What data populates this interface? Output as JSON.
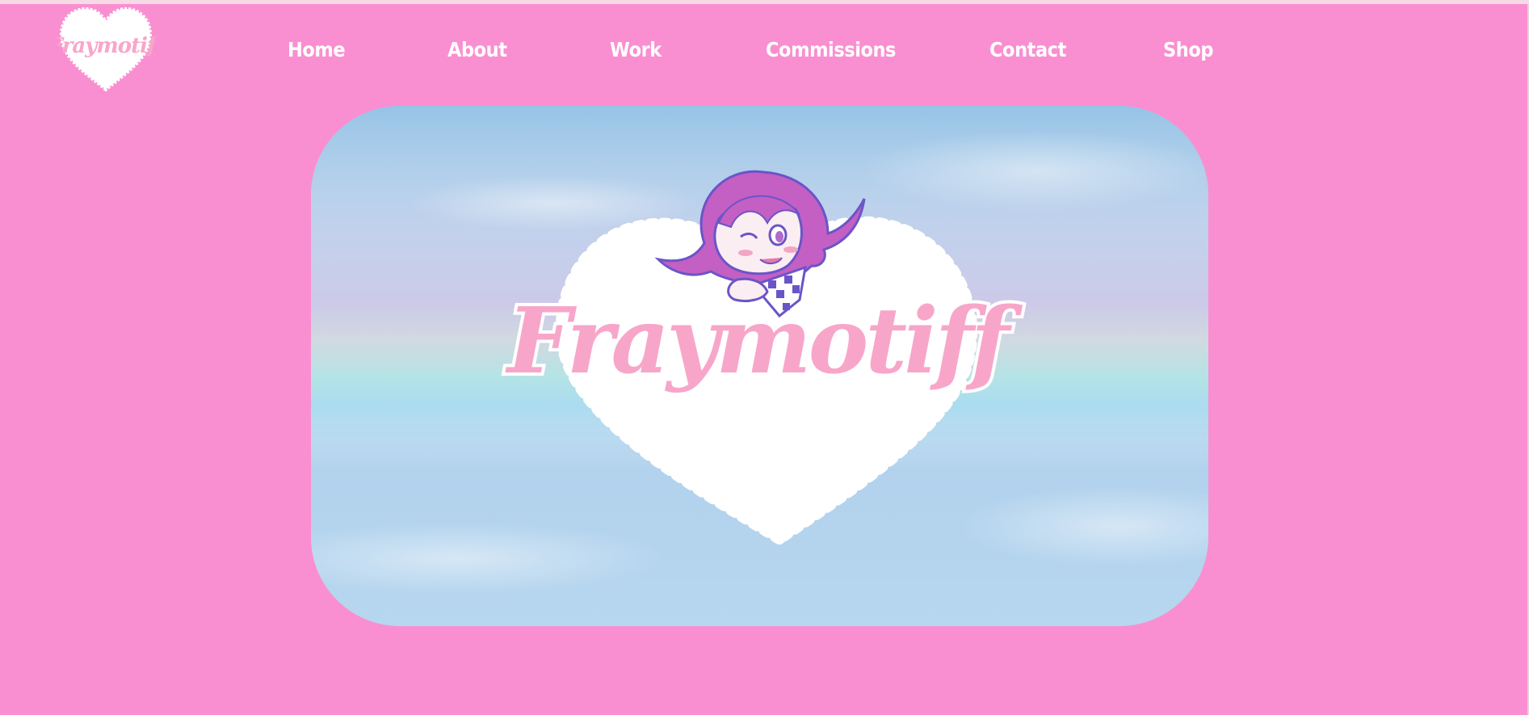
{
  "header": {
    "logo_text": "Fraymotiff",
    "nav": [
      {
        "label": "Home"
      },
      {
        "label": "About"
      },
      {
        "label": "Work"
      },
      {
        "label": "Commissions"
      },
      {
        "label": "Contact"
      },
      {
        "label": "Shop"
      }
    ]
  },
  "hero": {
    "logo_text": "Fraymotiff"
  },
  "colors": {
    "background": "#f98fd1",
    "logo_pink": "#f7a6c9",
    "mascot_hair": "#c45fc4",
    "mascot_outline": "#6a55c8"
  }
}
